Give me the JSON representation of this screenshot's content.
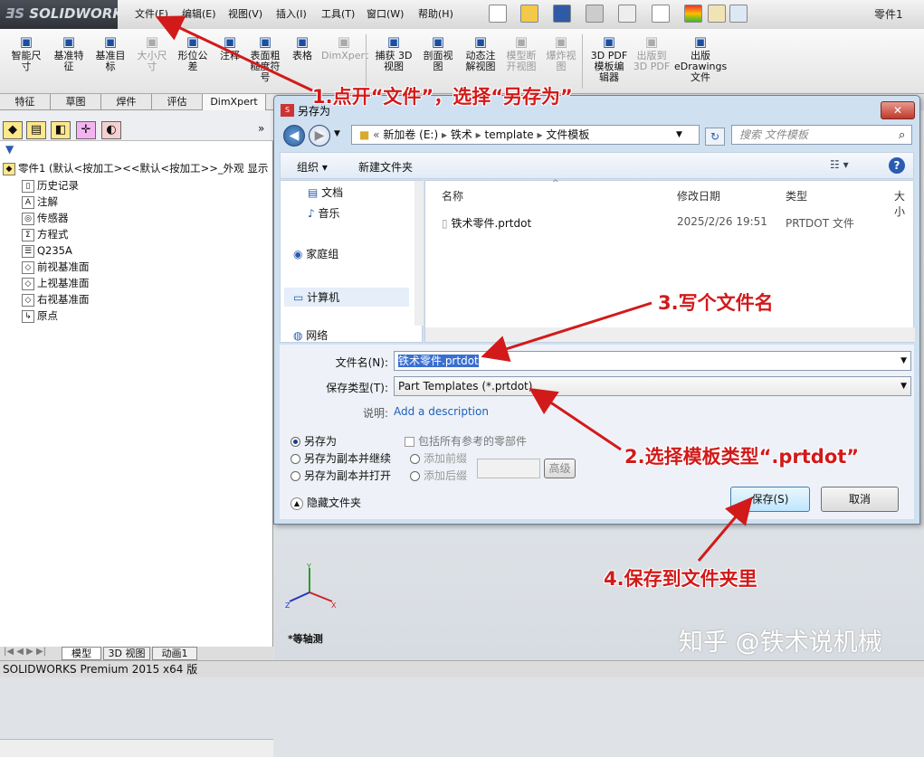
{
  "app": {
    "name": "SOLIDWORKS",
    "doc_title": "零件1",
    "status": "SOLIDWORKS Premium 2015 x64 版"
  },
  "menu": [
    "文件(F)",
    "编辑(E)",
    "视图(V)",
    "插入(I)",
    "工具(T)",
    "窗口(W)",
    "帮助(H)"
  ],
  "ribbon": [
    {
      "label": "智能尺\n寸",
      "icon": "smart-dimension-icon"
    },
    {
      "label": "基准特\n征",
      "icon": "datum-feature-icon"
    },
    {
      "label": "基准目\n标",
      "icon": "datum-target-icon"
    },
    {
      "label": "大小尺\n寸",
      "icon": "size-dimension-icon"
    },
    {
      "label": "形位公\n差",
      "icon": "geometric-tolerance-icon"
    },
    {
      "label": "注释",
      "icon": "note-icon"
    },
    {
      "label": "表面粗\n糙度符\n号",
      "icon": "surface-finish-icon"
    },
    {
      "label": "表格",
      "icon": "table-icon"
    },
    {
      "label": "DimXpert",
      "icon": "dimxpert-icon"
    },
    {
      "label": "捕获 3D\n视图",
      "icon": "capture-3d-icon"
    },
    {
      "label": "剖面视\n图",
      "icon": "section-view-icon"
    },
    {
      "label": "动态注\n解视图",
      "icon": "dynamic-annotation-icon"
    },
    {
      "label": "模型断\n开视图",
      "icon": "model-break-icon"
    },
    {
      "label": "爆炸视\n图",
      "icon": "explode-view-icon"
    },
    {
      "label": "3D PDF\n模板编\n辑器",
      "icon": "pdf-template-icon"
    },
    {
      "label": "出版到\n3D PDF",
      "icon": "publish-pdf-icon"
    },
    {
      "label": "出版\neDrawings\n文件",
      "icon": "edrawings-icon"
    }
  ],
  "cmd_tabs": [
    "特征",
    "草图",
    "焊件",
    "评估",
    "DimXpert"
  ],
  "tree": {
    "root": "零件1 (默认<按加工><<默认<按加工>>_外观 显示",
    "items": [
      "历史记录",
      "注解",
      "传感器",
      "方程式",
      "Q235A",
      "前视基准面",
      "上视基准面",
      "右视基准面",
      "原点"
    ]
  },
  "bottom_tabs": [
    "模型",
    "3D 视图",
    "动画1"
  ],
  "view": {
    "label": "*等轴测"
  },
  "dialog": {
    "title": "另存为",
    "path": [
      "新加卷 (E:)",
      "铁术",
      "template",
      "文件模板"
    ],
    "search_placeholder": "搜索 文件模板",
    "organize": "组织 ▾",
    "new_folder": "新建文件夹",
    "nav": [
      "文档",
      "音乐",
      "家庭组",
      "计算机",
      "网络"
    ],
    "columns": [
      "名称",
      "修改日期",
      "类型",
      "大小"
    ],
    "files": [
      {
        "name": "铁术零件.prtdot",
        "date": "2025/2/26 19:51",
        "type": "PRTDOT 文件"
      }
    ],
    "filename_label": "文件名(N):",
    "filename_value": "铁术零件.prtdot",
    "savetype_label": "保存类型(T):",
    "savetype_value": "Part Templates (*.prtdot)",
    "desc_label": "说明:",
    "desc_value": "Add a description",
    "radios": [
      "另存为",
      "另存为副本并继续",
      "另存为副本并打开"
    ],
    "include_refs": "包括所有参考的零部件",
    "prefix": "添加前缀",
    "suffix": "添加后缀",
    "advanced": "高级",
    "hide_folders": "隐藏文件夹",
    "save": "保存(S)",
    "cancel": "取消"
  },
  "annotations": [
    "1.点开“文件”，选择“另存为”",
    "2.选择模板类型“.prtdot”",
    "3.写个文件名",
    "4.保存到文件夹里"
  ],
  "watermark": "知乎 @铁术说机械",
  "colors": {
    "annotation": "#d21a1a",
    "dialog_frame": "#cfe0f1"
  }
}
